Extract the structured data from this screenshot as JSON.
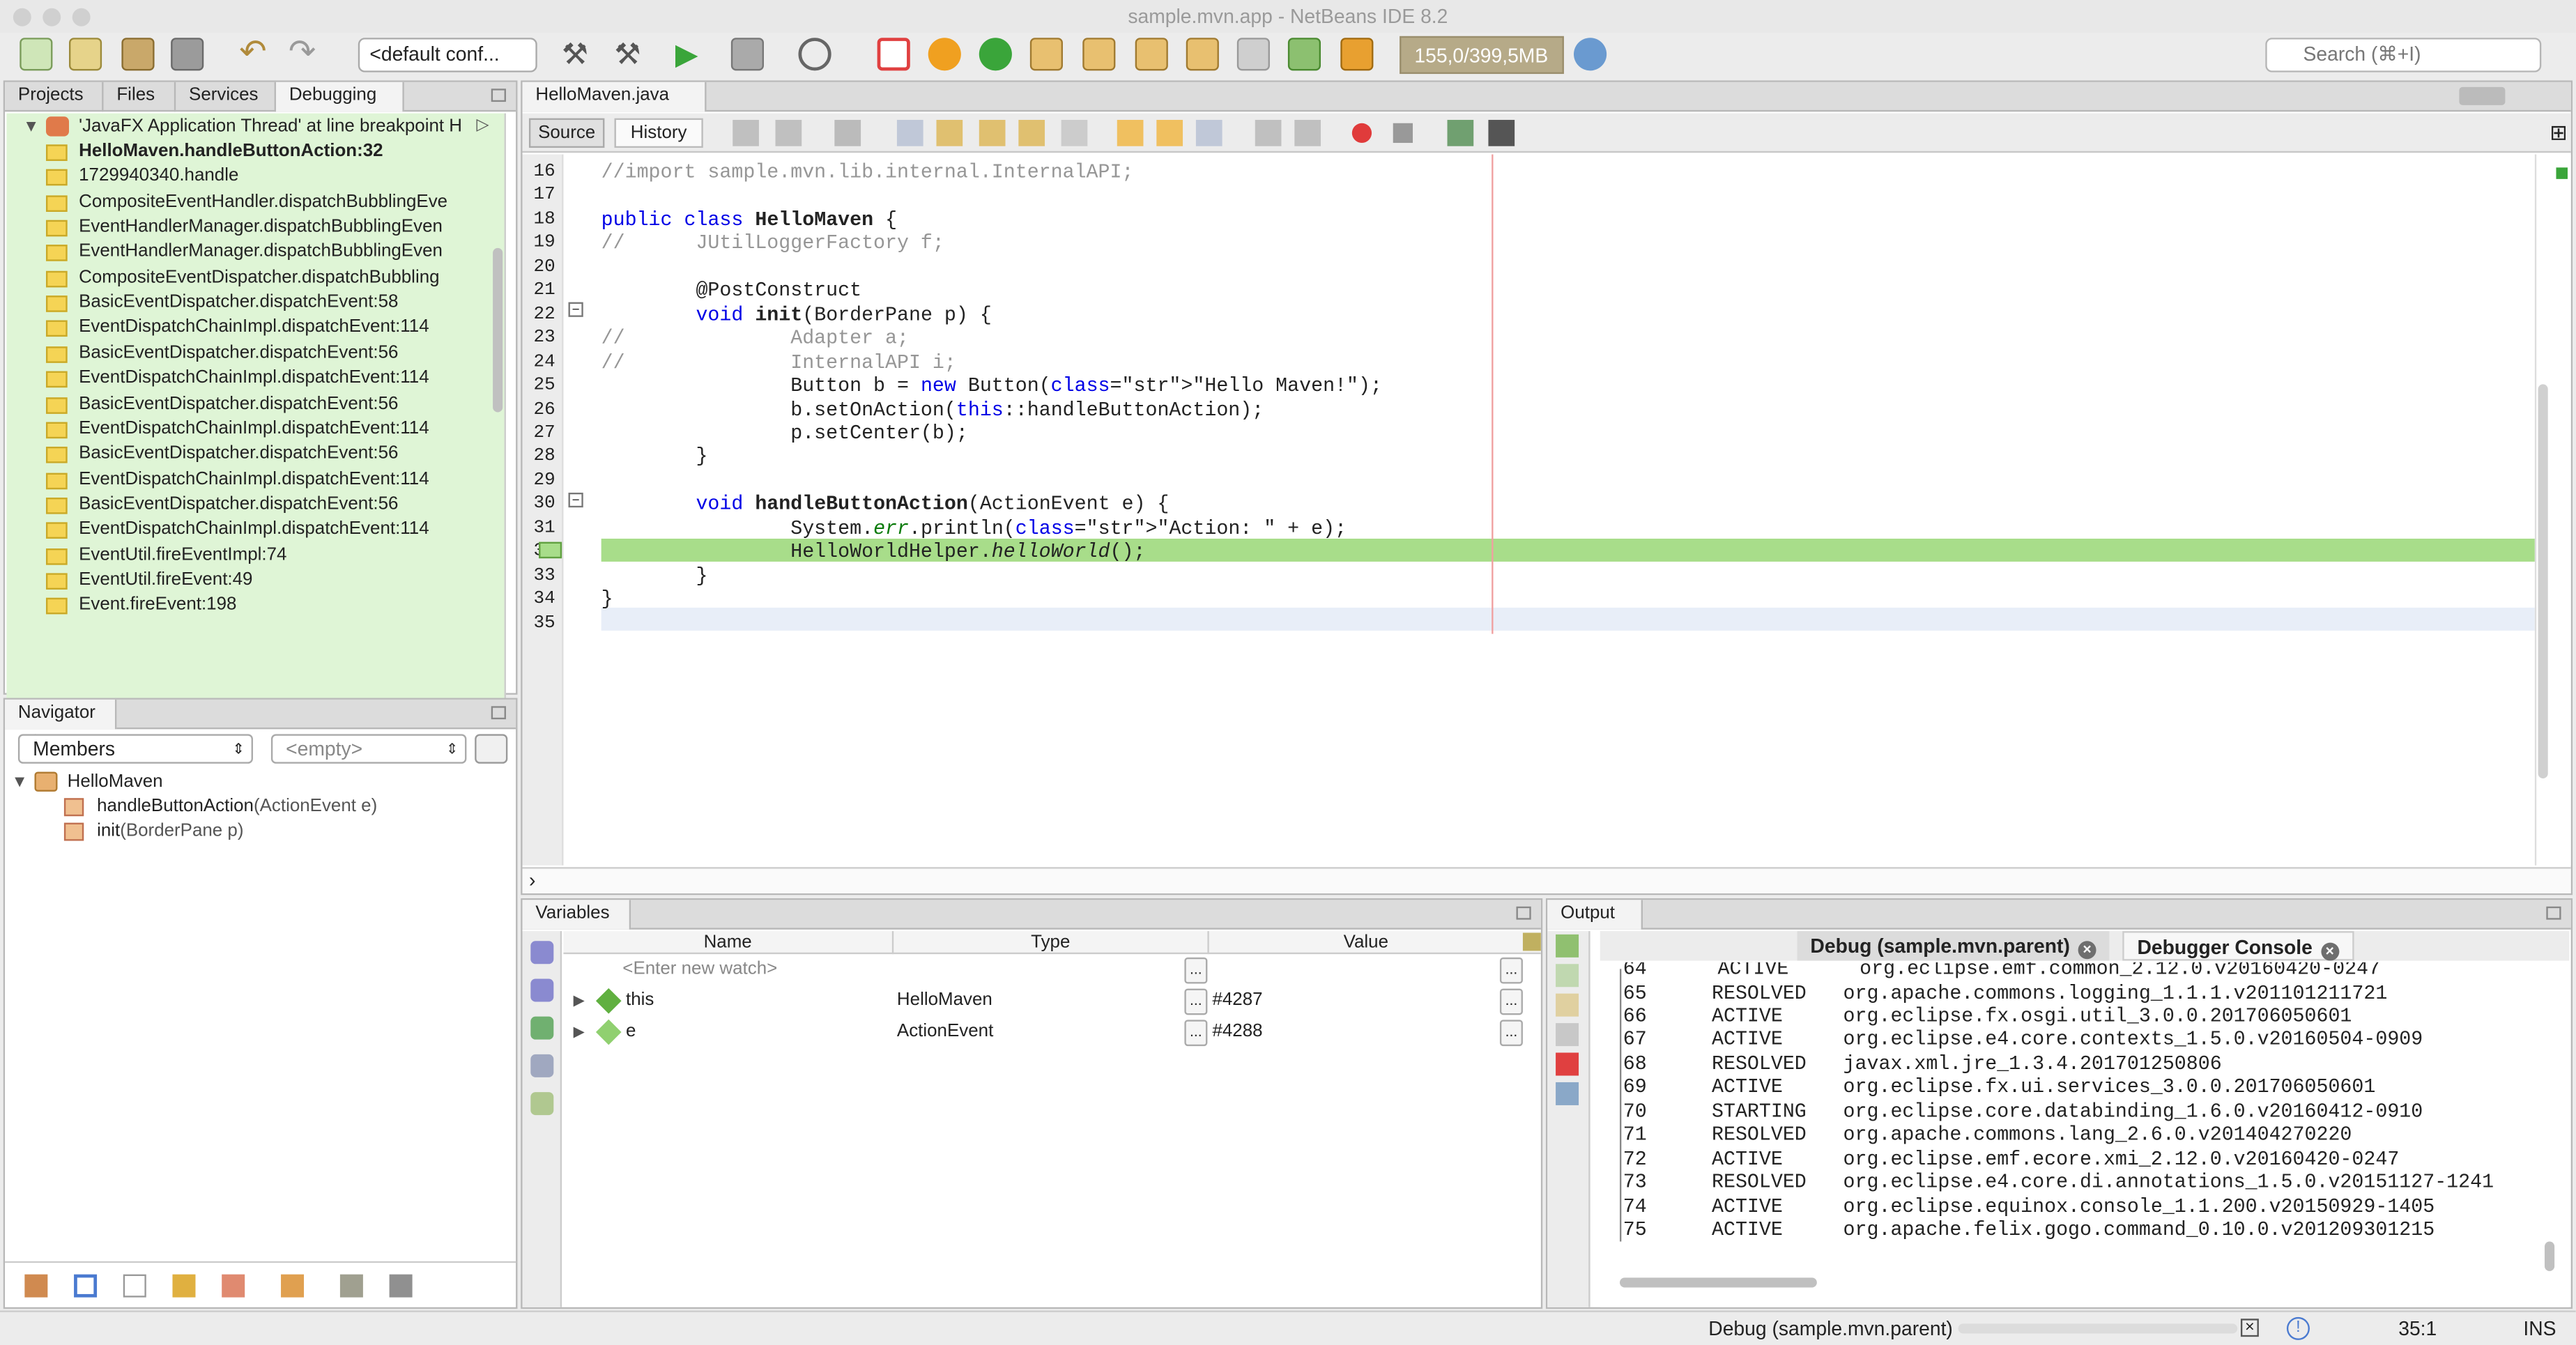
{
  "window": {
    "title": "sample.mvn.app - NetBeans IDE 8.2"
  },
  "toolbar": {
    "config": "<default conf...",
    "memory": "155,0/399,5MB",
    "search_placeholder": "Search (⌘+I)",
    "icons": [
      "new-file-icon",
      "new-project-icon",
      "open-project-icon",
      "close-project-icon",
      "undo-icon",
      "redo-icon",
      "build-icon",
      "clean-build-icon",
      "run-icon",
      "debug-icon",
      "profile-icon",
      "finish-debug-icon",
      "pause-icon",
      "continue-icon",
      "step-over-icon",
      "step-over-expr-icon",
      "step-into-icon",
      "step-out-icon",
      "run-to-cursor-icon",
      "apply-changes-icon",
      "snapshot-icon",
      "gc-icon"
    ]
  },
  "left_top": {
    "tabs": [
      "Projects",
      "Files",
      "Services",
      "Debugging"
    ],
    "thread": "'JavaFX Application Thread' at line breakpoint H",
    "frames": [
      "HelloMaven.handleButtonAction:32",
      "1729940340.handle",
      "CompositeEventHandler.dispatchBubblingEve",
      "EventHandlerManager.dispatchBubblingEven",
      "EventHandlerManager.dispatchBubblingEven",
      "CompositeEventDispatcher.dispatchBubbling",
      "BasicEventDispatcher.dispatchEvent:58",
      "EventDispatchChainImpl.dispatchEvent:114",
      "BasicEventDispatcher.dispatchEvent:56",
      "EventDispatchChainImpl.dispatchEvent:114",
      "BasicEventDispatcher.dispatchEvent:56",
      "EventDispatchChainImpl.dispatchEvent:114",
      "BasicEventDispatcher.dispatchEvent:56",
      "EventDispatchChainImpl.dispatchEvent:114",
      "BasicEventDispatcher.dispatchEvent:56",
      "EventDispatchChainImpl.dispatchEvent:114",
      "EventUtil.fireEventImpl:74",
      "EventUtil.fireEvent:49",
      "Event.fireEvent:198"
    ]
  },
  "navigator": {
    "tab": "Navigator",
    "members_combo": "Members",
    "filter_combo": "<empty>",
    "root": "HelloMaven",
    "items": [
      {
        "name": "handleButtonAction",
        "params": "(ActionEvent e)"
      },
      {
        "name": "init",
        "params": "(BorderPane p)"
      }
    ]
  },
  "editor": {
    "tab": "HelloMaven.java",
    "source_tab": "Source",
    "history_tab": "History",
    "current_line": "32",
    "lines": [
      {
        "n": "16",
        "text": "//import sample.mvn.lib.internal.InternalAPI;"
      },
      {
        "n": "17",
        "text": ""
      },
      {
        "n": "18",
        "text": "public class HelloMaven {"
      },
      {
        "n": "19",
        "text": "//      JUtilLoggerFactory f;"
      },
      {
        "n": "20",
        "text": ""
      },
      {
        "n": "21",
        "text": "        @PostConstruct"
      },
      {
        "n": "22",
        "text": "        void init(BorderPane p) {"
      },
      {
        "n": "23",
        "text": "//              Adapter a;"
      },
      {
        "n": "24",
        "text": "//              InternalAPI i;"
      },
      {
        "n": "25",
        "text": "                Button b = new Button(\"Hello Maven!\");"
      },
      {
        "n": "26",
        "text": "                b.setOnAction(this::handleButtonAction);"
      },
      {
        "n": "27",
        "text": "                p.setCenter(b);"
      },
      {
        "n": "28",
        "text": "        }"
      },
      {
        "n": "29",
        "text": ""
      },
      {
        "n": "30",
        "text": "        void handleButtonAction(ActionEvent e) {"
      },
      {
        "n": "31",
        "text": "                System.err.println(\"Action: \" + e);"
      },
      {
        "n": "32",
        "text": "                HelloWorldHelper.helloWorld();"
      },
      {
        "n": "33",
        "text": "        }"
      },
      {
        "n": "34",
        "text": "}"
      },
      {
        "n": "35",
        "text": ""
      }
    ]
  },
  "variables": {
    "tab": "Variables",
    "columns": [
      "Name",
      "Type",
      "Value"
    ],
    "watch_placeholder": "<Enter new watch>",
    "rows": [
      {
        "name": "this",
        "type": "HelloMaven",
        "value": "#4287"
      },
      {
        "name": "e",
        "type": "ActionEvent",
        "value": "#4288"
      }
    ]
  },
  "output": {
    "tab": "Output",
    "subtabs": [
      "Debug (sample.mvn.parent)",
      "Debugger Console"
    ],
    "partial_top": "64      ACTIVE      org.eclipse.emf.common_2.12.0.v20160420-0247",
    "lines": [
      {
        "id": "65",
        "state": "RESOLVED",
        "bundle": "org.apache.commons.logging_1.1.1.v201101211721"
      },
      {
        "id": "66",
        "state": "ACTIVE",
        "bundle": "org.eclipse.fx.osgi.util_3.0.0.201706050601"
      },
      {
        "id": "67",
        "state": "ACTIVE",
        "bundle": "org.eclipse.e4.core.contexts_1.5.0.v20160504-0909"
      },
      {
        "id": "68",
        "state": "RESOLVED",
        "bundle": "javax.xml.jre_1.3.4.201701250806"
      },
      {
        "id": "69",
        "state": "ACTIVE",
        "bundle": "org.eclipse.fx.ui.services_3.0.0.201706050601"
      },
      {
        "id": "70",
        "state": "STARTING",
        "bundle": "org.eclipse.core.databinding_1.6.0.v20160412-0910"
      },
      {
        "id": "71",
        "state": "RESOLVED",
        "bundle": "org.apache.commons.lang_2.6.0.v201404270220"
      },
      {
        "id": "72",
        "state": "ACTIVE",
        "bundle": "org.eclipse.emf.ecore.xmi_2.12.0.v20160420-0247"
      },
      {
        "id": "73",
        "state": "RESOLVED",
        "bundle": "org.eclipse.e4.core.di.annotations_1.5.0.v20151127-1241"
      },
      {
        "id": "74",
        "state": "ACTIVE",
        "bundle": "org.eclipse.equinox.console_1.1.200.v20150929-1405"
      },
      {
        "id": "75",
        "state": "ACTIVE",
        "bundle": "org.apache.felix.gogo.command_0.10.0.v201209301215"
      }
    ]
  },
  "statusbar": {
    "task": "Debug (sample.mvn.parent)",
    "position": "35:1",
    "mode": "INS"
  },
  "colors": {
    "debug_bg": "#dff5d6",
    "current_line": "#a8dd8a",
    "keyword": "#0000e6",
    "string": "#ce7b00",
    "comment": "#969696"
  }
}
